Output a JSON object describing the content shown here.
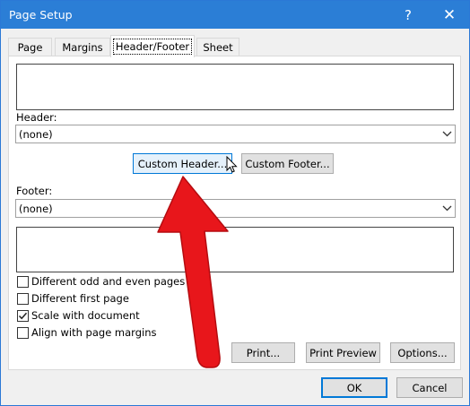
{
  "window": {
    "title": "Page Setup",
    "help_glyph": "?",
    "close_glyph": "✕"
  },
  "tabs": [
    {
      "label": "Page"
    },
    {
      "label": "Margins"
    },
    {
      "label": "Header/Footer"
    },
    {
      "label": "Sheet"
    }
  ],
  "header": {
    "label": "Header:",
    "value": "(none)"
  },
  "buttons": {
    "custom_header": "Custom Header...",
    "custom_footer": "Custom Footer...",
    "print": "Print...",
    "print_preview": "Print Preview",
    "options": "Options...",
    "ok": "OK",
    "cancel": "Cancel"
  },
  "footer": {
    "label": "Footer:",
    "value": "(none)"
  },
  "options": [
    {
      "label": "Different odd and even pages",
      "checked": false
    },
    {
      "label": "Different first page",
      "checked": false
    },
    {
      "label": "Scale with document",
      "checked": true
    },
    {
      "label": "Align with page margins",
      "checked": false
    }
  ],
  "colors": {
    "titlebar": "#2b7ed6",
    "accent_border": "#0078d7",
    "annotation_arrow": "#e8161b"
  }
}
